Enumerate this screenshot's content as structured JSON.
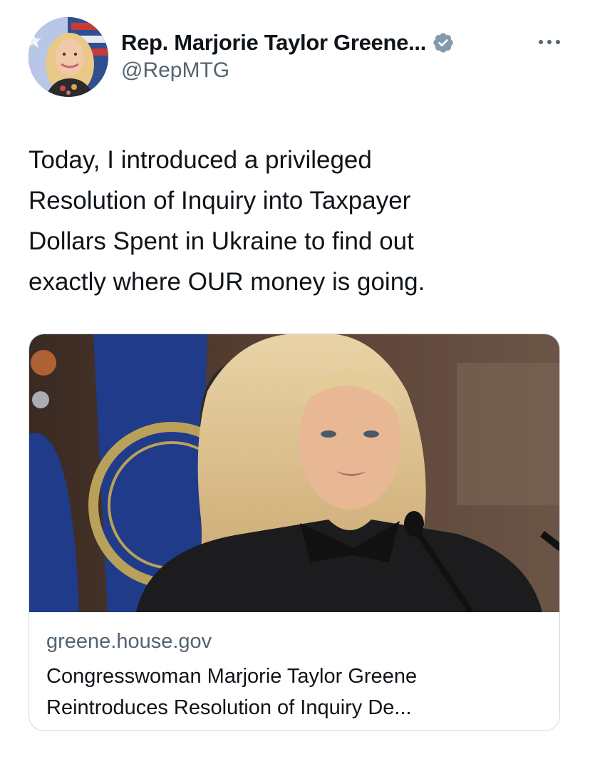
{
  "author": {
    "display_name": "Rep. Marjorie Taylor Greene...",
    "handle": "@RepMTG",
    "verified_icon": "verified-badge-icon",
    "verified_color": "#829aab"
  },
  "tweet": {
    "text": "Today, I introduced a privileged\nResolution of Inquiry into Taxpayer\nDollars Spent in Ukraine to find out\nexactly where OUR money is going."
  },
  "link_card": {
    "domain": "greene.house.gov",
    "title_line_1": "Congresswoman Marjorie Taylor Greene",
    "title_line_2": "Reintroduces Resolution of Inquiry De..."
  },
  "icons": {
    "more": "more-options-icon"
  },
  "colors": {
    "text_primary": "#0f1419",
    "text_secondary": "#536471",
    "card_border": "#cfd9de"
  }
}
